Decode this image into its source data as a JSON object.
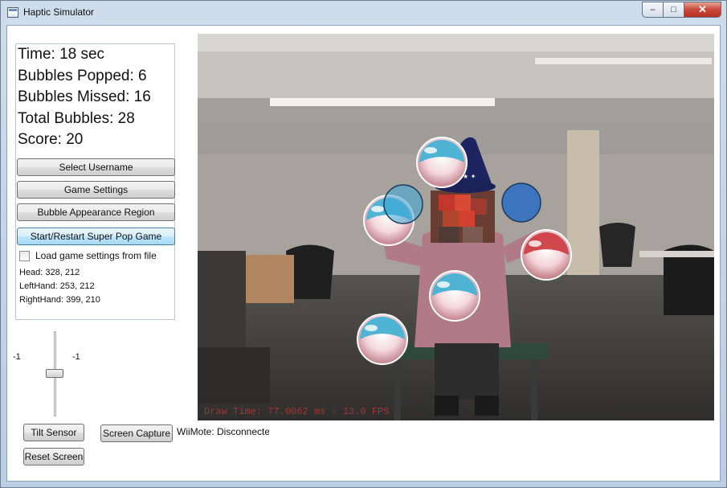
{
  "window": {
    "title": "Haptic Simulator",
    "controls": {
      "minimize": "–",
      "maximize": "□",
      "close": "✕"
    }
  },
  "stats": {
    "time": "Time: 18 sec",
    "popped": "Bubbles Popped: 6",
    "missed": "Bubbles Missed: 16",
    "total": "Total Bubbles: 28",
    "score": "Score: 20"
  },
  "buttons": {
    "select_username": "Select Username",
    "game_settings": "Game Settings",
    "bubble_region": "Bubble Appearance Region",
    "start_game": "Start/Restart Super Pop Game",
    "tilt_sensor": "Tilt Sensor",
    "screen_capture": "Screen Capture",
    "reset_screen": "Reset Screen"
  },
  "load_settings": {
    "label": "Load game settings from file",
    "checked": false
  },
  "tracking": {
    "head": "Head: 328, 212",
    "left_hand": "LeftHand: 253, 212",
    "right_hand": "RightHand: 399, 210"
  },
  "tilt_slider": {
    "min_label": "-1",
    "value_label": "-1"
  },
  "wiimote_status": "WiiMote: Disconnected",
  "camera_view": {
    "fps_overlay": "Draw Time: 77.0062 ms - 13.0 FPS"
  },
  "colors": {
    "bubble_aqua": "#4fb3d3",
    "bubble_red": "#d0484e",
    "hand_marker_blue": "#2a6cc4",
    "accent_focus": "#3c7fb1"
  }
}
